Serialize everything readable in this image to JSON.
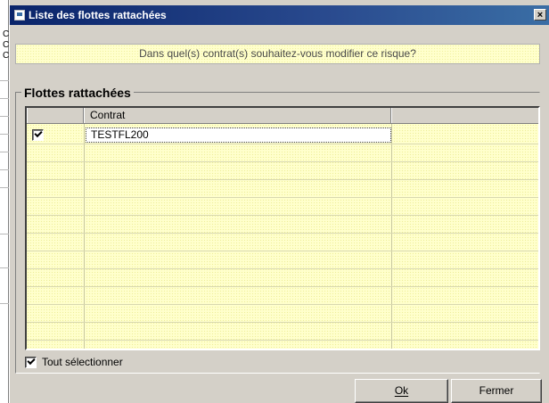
{
  "window": {
    "title": "Liste des flottes rattachées",
    "close_glyph": "×"
  },
  "question": "Dans quel(s) contrat(s) souhaitez-vous modifier ce risque?",
  "group": {
    "title": "Flottes rattachées"
  },
  "table": {
    "columns": [
      "",
      "Contrat",
      ""
    ],
    "rows": [
      {
        "checked": true,
        "contrat": "TESTFL200"
      }
    ]
  },
  "select_all": {
    "label": "Tout sélectionner",
    "checked": true
  },
  "buttons": {
    "ok": "Ok",
    "close": "Fermer"
  },
  "background_left": {
    "texts": [
      "C",
      "C",
      "C"
    ]
  },
  "colors": {
    "title_start": "#0a246a",
    "title_end": "#3a6ea5",
    "grid_bg": "#ffffcc",
    "face": "#d4d0c8"
  }
}
